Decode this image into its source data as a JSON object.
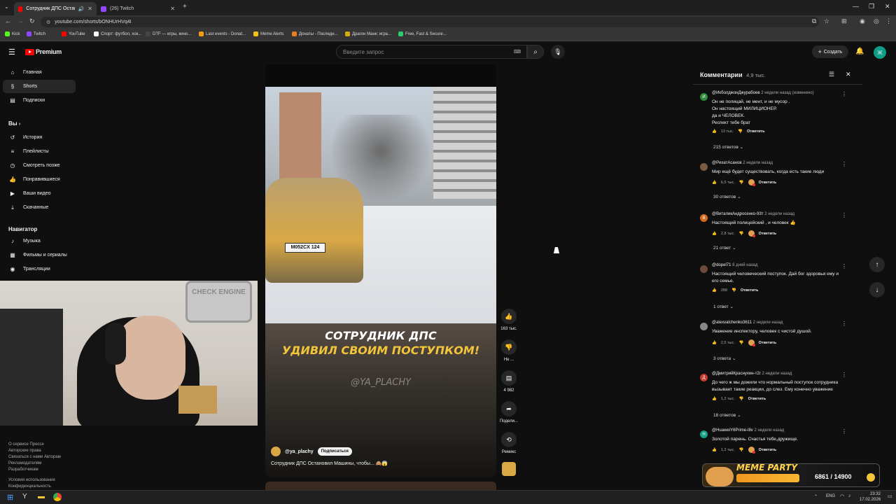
{
  "browser": {
    "tabs": [
      {
        "title": "Сотрудник ДПС Остановил",
        "active": true
      },
      {
        "title": "(26) Twitch",
        "active": false
      }
    ],
    "url": "youtube.com/shorts/bONHUrHVq4I",
    "bookmarks": [
      "Kick",
      "Twitch",
      "YouTube",
      "Спорт: футбол, хок...",
      "DTF — игры, кино...",
      "Last events - Donat...",
      "Meme Alerts",
      "Донаты - Последн...",
      "Драгон Манк: игра...",
      "Free, Fast & Secure..."
    ]
  },
  "youtube": {
    "logo": "Premium",
    "search_placeholder": "Введите запрос",
    "create_label": "Создать",
    "avatar_letter": "Ж"
  },
  "sidebar": {
    "main": [
      {
        "label": "Главная",
        "icon": "home-icon"
      },
      {
        "label": "Shorts",
        "icon": "shorts-icon",
        "selected": true
      },
      {
        "label": "Подписки",
        "icon": "subscriptions-icon"
      }
    ],
    "you_heading": "Вы",
    "you": [
      {
        "label": "История",
        "icon": "history-icon"
      },
      {
        "label": "Плейлисты",
        "icon": "playlists-icon"
      },
      {
        "label": "Смотреть позже",
        "icon": "watch-later-icon"
      },
      {
        "label": "Понравившиеся",
        "icon": "liked-icon"
      },
      {
        "label": "Ваши видео",
        "icon": "your-videos-icon"
      },
      {
        "label": "Скачанные",
        "icon": "downloads-icon"
      }
    ],
    "nav_heading": "Навигатор",
    "nav": [
      {
        "label": "Музыка",
        "icon": "music-icon"
      },
      {
        "label": "Фильмы и сериалы",
        "icon": "movies-icon"
      },
      {
        "label": "Трансляции",
        "icon": "live-icon"
      }
    ],
    "footer": [
      "О сервисе  Прессе",
      "Авторские права",
      "Связаться с нами  Авторам",
      "Рекламодателям",
      "Разработчикам",
      "",
      "Условия использования",
      "Конфиденциальность"
    ]
  },
  "short": {
    "caption_line1": "СОТРУДНИК ДПС",
    "caption_line2": "УДИВИЛ СВОИМ ПОСТУПКОМ!",
    "watermark": "@YA_PLACHY",
    "plate": "M052CX 124",
    "channel": "@ya_plachy",
    "subscribe": "Подписаться",
    "title": "Сотрудник ДПС Остановил Машины, чтобы... 🙈😱",
    "actions": [
      {
        "icon": "like-icon",
        "label": "163 тыс."
      },
      {
        "icon": "dislike-icon",
        "label": "Не ..."
      },
      {
        "icon": "comment-icon",
        "label": "4 982"
      },
      {
        "icon": "share-icon",
        "label": "Подели..."
      },
      {
        "icon": "remix-icon",
        "label": "Ремикс"
      }
    ]
  },
  "comments": {
    "title": "Комментарии",
    "count": "4,9 тыс.",
    "items": [
      {
        "author": "@ИкболджонДжурабоев",
        "time": "2 недели назад (изменено)",
        "avatar": "И",
        "avatar_color": "#2e8b3e",
        "text": [
          "Он не полицай, не мент, и не мусор .",
          "Он настоящий МИЛИЦИОНЕР.",
          "да и ЧЕЛОВЕК.",
          "Респект тебе брат"
        ],
        "likes": "13 тыс.",
        "reply": "Ответить",
        "replies": "215 ответов",
        "heart": false
      },
      {
        "author": "@РихатАсанов",
        "time": "2 недели назад",
        "avatar": "",
        "avatar_color": "#7a5a40",
        "text": [
          "Мир ещё будет существовать, когда есть такие люди"
        ],
        "likes": "6,5 тыс.",
        "reply": "Ответить",
        "replies": "30 ответов",
        "heart": true
      },
      {
        "author": "@ВиталикАндросенко-93т",
        "time": "2 недели назад",
        "avatar": "В",
        "avatar_color": "#d46a1e",
        "text": [
          "Настоящий полицейский , и человек 👍"
        ],
        "likes": "2,8 тыс.",
        "reply": "Ответить",
        "replies": "21 ответ",
        "heart": true
      },
      {
        "author": "@dopel71",
        "time": "8 дней назад",
        "avatar": "",
        "avatar_color": "#6b4a3a",
        "text": [
          "Настоящий человеческий поступок. Дай бог здоровья ему и",
          "его семье."
        ],
        "likes": "288",
        "reply": "Ответить",
        "replies": "1 ответ",
        "heart": false
      },
      {
        "author": "@alexvalchenko3611",
        "time": "2 недели назад",
        "avatar": "",
        "avatar_color": "#888888",
        "text": [
          "Уважение инспектору, человек с чистой душой."
        ],
        "likes": "2,5 тыс.",
        "reply": "Ответить",
        "replies": "3 ответа",
        "heart": true
      },
      {
        "author": "@ДмитрийКраснухин-т2г",
        "time": "2 недели назад",
        "avatar": "Д",
        "avatar_color": "#c0392b",
        "text": [
          "До чего ж мы дожили что нормальный поступок сотрудника",
          "вызывает такие реакции, до слез. Ему конечно уважение"
        ],
        "likes": "1,2 тыс.",
        "reply": "Ответить",
        "replies": "18 ответов",
        "heart": false
      },
      {
        "author": "@HuaweiY6Prime-l8v",
        "time": "2 недели назад",
        "avatar": "Н",
        "avatar_color": "#16a085",
        "text": [
          "Золотой парень. Счастья тебе,дружище."
        ],
        "likes": "1,2 тыс.",
        "reply": "Ответить",
        "replies": "",
        "heart": true
      }
    ]
  },
  "overlay": {
    "meme_party": "MEME PARTY",
    "score": "6861 / 14900"
  },
  "webcam": {
    "sign": "CHECK ENGINE"
  },
  "taskbar": {
    "lang": "ENG",
    "time": "23:32",
    "date": "17.02.2026"
  }
}
